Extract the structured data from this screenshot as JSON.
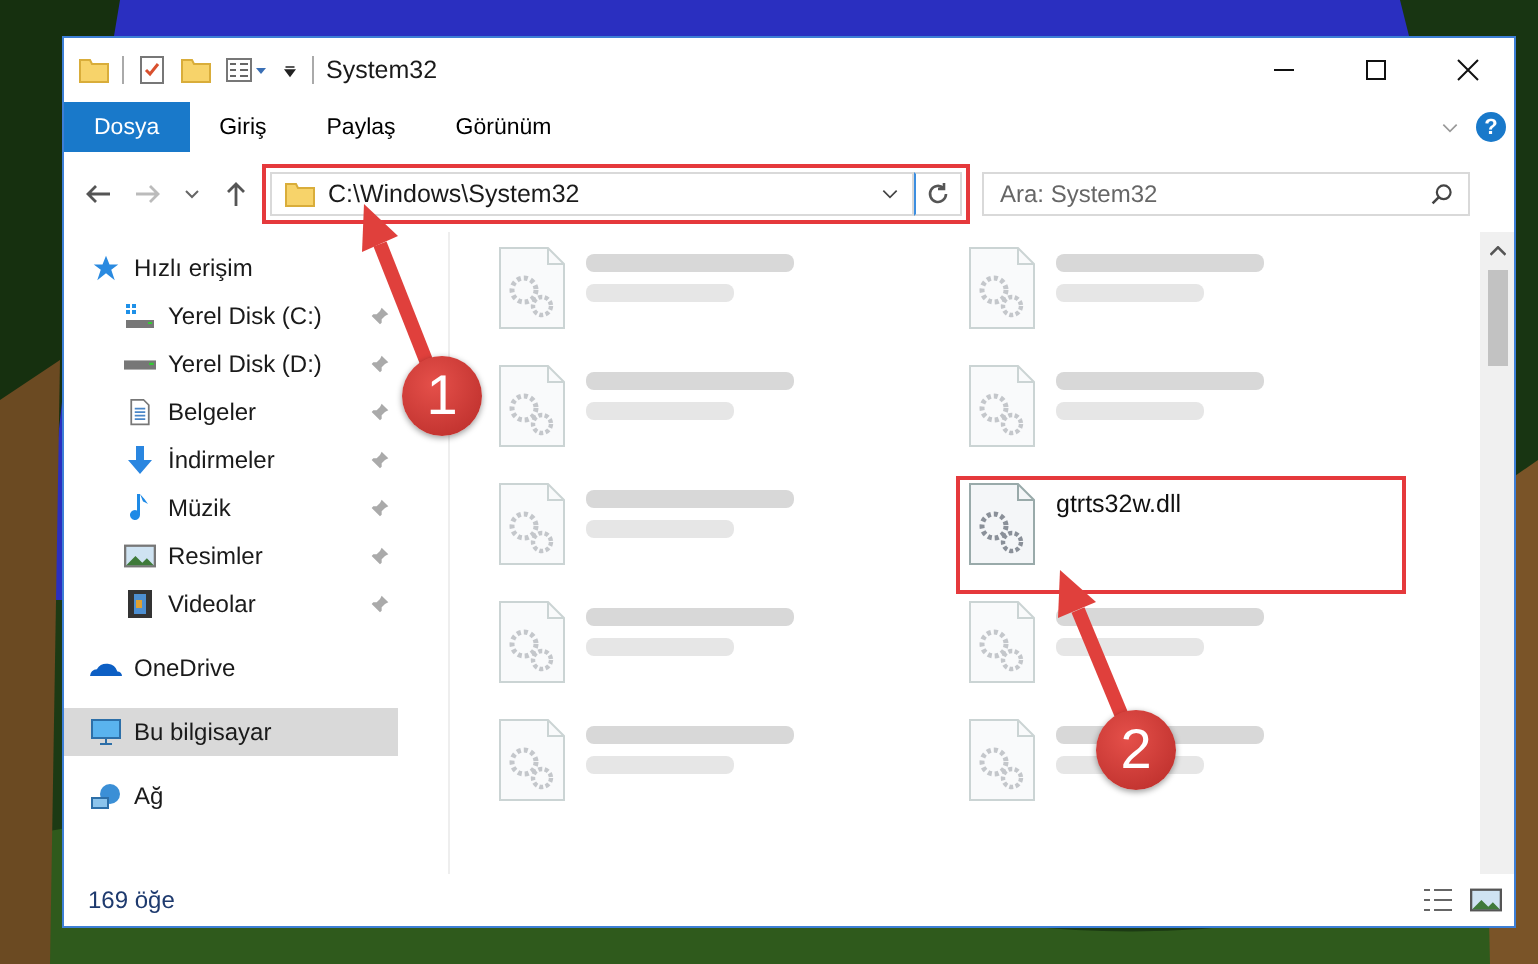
{
  "window": {
    "title": "System32"
  },
  "ribbon": {
    "tabs": [
      {
        "label": "Dosya",
        "selected": true
      },
      {
        "label": "Giriş",
        "selected": false
      },
      {
        "label": "Paylaş",
        "selected": false
      },
      {
        "label": "Görünüm",
        "selected": false
      }
    ],
    "help": "?"
  },
  "address": {
    "path": "C:\\Windows\\System32",
    "highlighted": true
  },
  "search": {
    "placeholder": "Ara: System32"
  },
  "nav": [
    {
      "label": "Hızlı erişim",
      "kind": "star",
      "pinned": false,
      "selected": false,
      "children": [
        {
          "label": "Yerel Disk (C:)",
          "kind": "drive-win",
          "pinned": true,
          "selected": false
        },
        {
          "label": "Yerel Disk (D:)",
          "kind": "drive",
          "pinned": true,
          "selected": false
        },
        {
          "label": "Belgeler",
          "kind": "doc",
          "pinned": true,
          "selected": false
        },
        {
          "label": "İndirmeler",
          "kind": "download",
          "pinned": true,
          "selected": false
        },
        {
          "label": "Müzik",
          "kind": "music",
          "pinned": true,
          "selected": false
        },
        {
          "label": "Resimler",
          "kind": "pictures",
          "pinned": true,
          "selected": false
        },
        {
          "label": "Videolar",
          "kind": "video",
          "pinned": true,
          "selected": false
        }
      ]
    },
    {
      "label": "OneDrive",
      "kind": "cloud",
      "pinned": false,
      "selected": false
    },
    {
      "label": "Bu bilgisayar",
      "kind": "computer",
      "pinned": false,
      "selected": true
    },
    {
      "label": "Ağ",
      "kind": "network",
      "pinned": false,
      "selected": false
    }
  ],
  "files": [
    {
      "blurred": true,
      "highlighted": false
    },
    {
      "blurred": true,
      "highlighted": false
    },
    {
      "blurred": true,
      "highlighted": false
    },
    {
      "blurred": true,
      "highlighted": false
    },
    {
      "blurred": true,
      "highlighted": false
    },
    {
      "name": "gtrts32w.dll",
      "blurred": false,
      "highlighted": true
    },
    {
      "blurred": true,
      "highlighted": false
    },
    {
      "blurred": true,
      "highlighted": false
    },
    {
      "blurred": true,
      "highlighted": false
    },
    {
      "blurred": true,
      "highlighted": false
    }
  ],
  "status_bar": {
    "count": "169 öğe"
  },
  "annotations": [
    {
      "label": "1"
    },
    {
      "label": "2"
    }
  ]
}
